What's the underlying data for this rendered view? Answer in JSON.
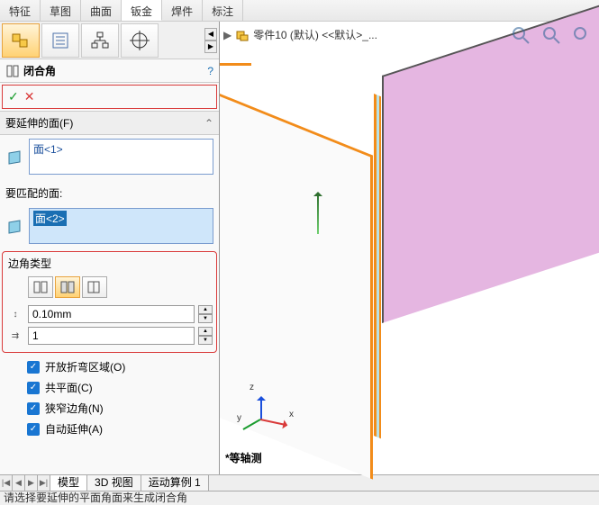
{
  "menu": {
    "tabs": [
      "特征",
      "草图",
      "曲面",
      "钣金",
      "焊件",
      "标注"
    ],
    "active_index": 3
  },
  "left_toolbar": {
    "tools": [
      "feature-tree",
      "details-tree",
      "hierarchy",
      "crosshair"
    ],
    "active_index": 0
  },
  "panel": {
    "title_icon": "closed-corner-icon",
    "title": "闭合角",
    "help": "?"
  },
  "actions": {
    "ok": "✓",
    "cancel": "✕"
  },
  "extend_faces": {
    "header": "要延伸的面(F)",
    "items": [
      "面<1>"
    ]
  },
  "match_faces": {
    "header": "要匹配的面:",
    "items": [
      "面<2>"
    ]
  },
  "corner": {
    "group_title": "边角类型",
    "types": [
      "type-a",
      "type-b",
      "type-c"
    ],
    "active_type_index": 1,
    "gap_icon": "↕",
    "gap_value": "0.10mm",
    "ratio_icon": "⇉",
    "ratio_value": "1"
  },
  "options": {
    "open_bend": {
      "label": "开放折弯区域(O)",
      "checked": true
    },
    "coplanar": {
      "label": "共平面(C)",
      "checked": true
    },
    "narrow": {
      "label": "狭窄边角(N)",
      "checked": true
    },
    "auto_ext": {
      "label": "自动延伸(A)",
      "checked": true
    }
  },
  "viewport": {
    "tools": [
      "zoom-fit",
      "zoom-area",
      "zoom-window"
    ],
    "breadcrumb_part": "零件10 (默认) <<默认>_...",
    "view_label": "*等轴测",
    "triad": {
      "x": "x",
      "y": "y",
      "z": "z"
    }
  },
  "bottom_tabs": {
    "nav": [
      "|◀",
      "◀",
      "▶",
      "▶|"
    ],
    "tabs": [
      "模型",
      "3D 视图",
      "运动算例 1"
    ],
    "active_index": 0
  },
  "status": "请选择要延伸的平面角面来生成闭合角"
}
